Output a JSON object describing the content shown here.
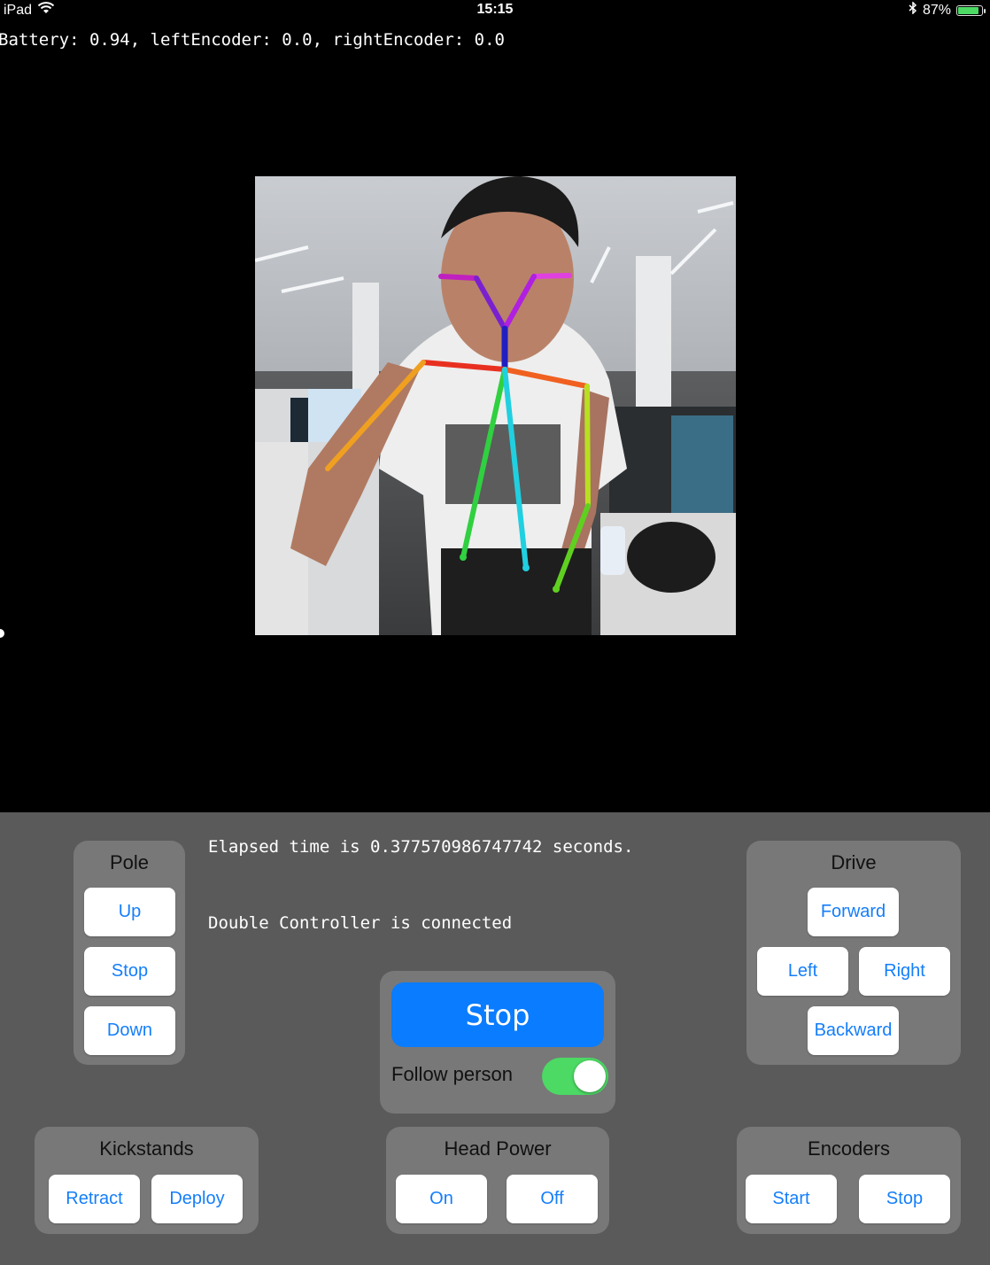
{
  "status_bar": {
    "device": "iPad",
    "time": "15:15",
    "battery_percent": "87%",
    "battery_level": 0.87,
    "icons": [
      "wifi-icon",
      "bluetooth-icon",
      "battery-icon"
    ]
  },
  "telemetry": {
    "text": "Battery: 0.94, leftEncoder: 0.0, rightEncoder: 0.0"
  },
  "camera": {
    "description_icon": "camera-feed-with-pose-skeleton"
  },
  "messages": {
    "elapsed": "Elapsed time is 0.377570986747742 seconds.",
    "connection": "Double Controller is connected"
  },
  "pole": {
    "title": "Pole",
    "up": "Up",
    "stop": "Stop",
    "down": "Down"
  },
  "drive": {
    "title": "Drive",
    "forward": "Forward",
    "left": "Left",
    "right": "Right",
    "backward": "Backward"
  },
  "center": {
    "stop": "Stop",
    "follow_label": "Follow person",
    "follow_on": true
  },
  "kickstands": {
    "title": "Kickstands",
    "retract": "Retract",
    "deploy": "Deploy"
  },
  "head_power": {
    "title": "Head Power",
    "on": "On",
    "off": "Off"
  },
  "encoders": {
    "title": "Encoders",
    "start": "Start",
    "stop": "Stop"
  },
  "colors": {
    "accent": "#147efb",
    "primary_button": "#0a7cff",
    "toggle_on": "#4cd964",
    "panel_bg": "#5a5a5a",
    "group_bg": "#787878"
  }
}
